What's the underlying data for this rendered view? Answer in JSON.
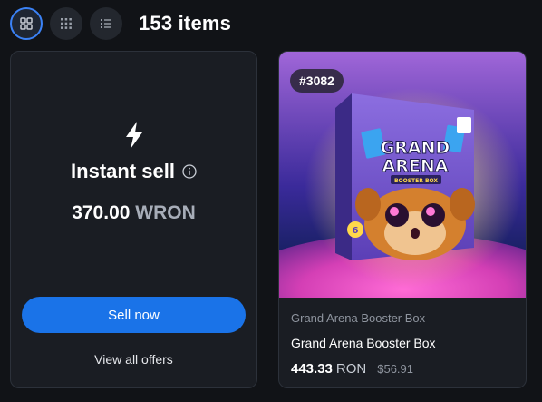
{
  "toolbar": {
    "items_count": "153 items",
    "view_modes": [
      {
        "name": "grid-large",
        "icon": "grid-icon",
        "active": true
      },
      {
        "name": "grid-small",
        "icon": "dense-grid-icon",
        "active": false
      },
      {
        "name": "list",
        "icon": "list-icon",
        "active": false
      }
    ]
  },
  "sell_card": {
    "icon": "lightning-icon",
    "title": "Instant sell",
    "info_icon": "info-icon",
    "price_amount": "370.00",
    "price_unit": "WRON",
    "sell_button": "Sell now",
    "view_all_link": "View all offers"
  },
  "item_card": {
    "badge": "#3082",
    "art_title_line1": "GRAND",
    "art_title_line2": "ARENA",
    "art_subtitle": "BOOSTER BOX",
    "collection": "Grand Arena Booster Box",
    "name": "Grand Arena Booster Box",
    "price_amount": "443.33",
    "price_unit": "RON",
    "usd_price": "$56.91"
  },
  "colors": {
    "background": "#111317",
    "card": "#1a1d23",
    "accent": "#1a73e8",
    "muted": "#8e949e"
  }
}
